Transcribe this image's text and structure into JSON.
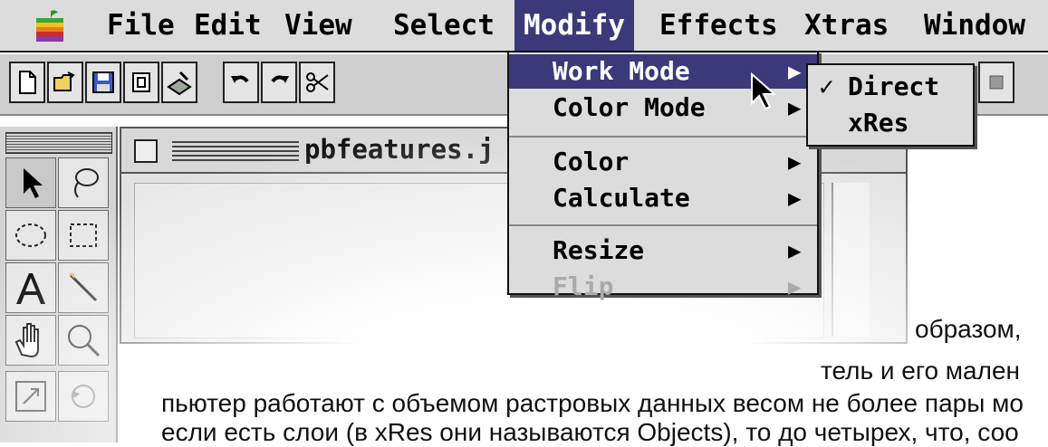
{
  "menubar": {
    "items": [
      "File",
      "Edit",
      "View",
      "Select",
      "Modify",
      "Effects",
      "Xtras",
      "Window"
    ],
    "active": "Modify"
  },
  "document": {
    "title": "pbfeatures.j"
  },
  "modify_menu": {
    "items": [
      {
        "label": "Work Mode",
        "submenu": true,
        "highlighted": true
      },
      {
        "label": "Color Mode",
        "submenu": true
      },
      {
        "label": "Color",
        "submenu": true
      },
      {
        "label": "Calculate",
        "submenu": true
      },
      {
        "label": "Resize",
        "submenu": true
      },
      {
        "label": "Flip",
        "submenu": true
      }
    ]
  },
  "work_mode_submenu": {
    "items": [
      {
        "label": "Direct",
        "checked": true
      },
      {
        "label": "xRes",
        "checked": false
      }
    ],
    "check_glyph": "✓"
  },
  "article": {
    "line1": "образом,",
    "line2": "тель и его мален",
    "line3": "пьютер работают с объемом растровых данных весом не более пары мо",
    "line4": "если есть слои (в xRes они называются Objects), то до четырех, что, соо"
  },
  "icons": {
    "toolbar": [
      "new-document-icon",
      "open-folder-icon",
      "save-disk-icon",
      "import-icon",
      "export-icon",
      "undo-icon",
      "redo-icon",
      "cut-scissors-icon"
    ],
    "tools": [
      "arrow-tool-icon",
      "lasso-tool-icon",
      "ellipse-marquee-icon",
      "rect-marquee-icon",
      "text-tool-icon",
      "wand-tool-icon",
      "hand-tool-icon",
      "zoom-tool-icon",
      "transform-tool-icon",
      "rotate-tool-icon"
    ]
  },
  "colors": {
    "menu_highlight": "#3a3a7a",
    "menu_bg": "#dcdcdc"
  }
}
